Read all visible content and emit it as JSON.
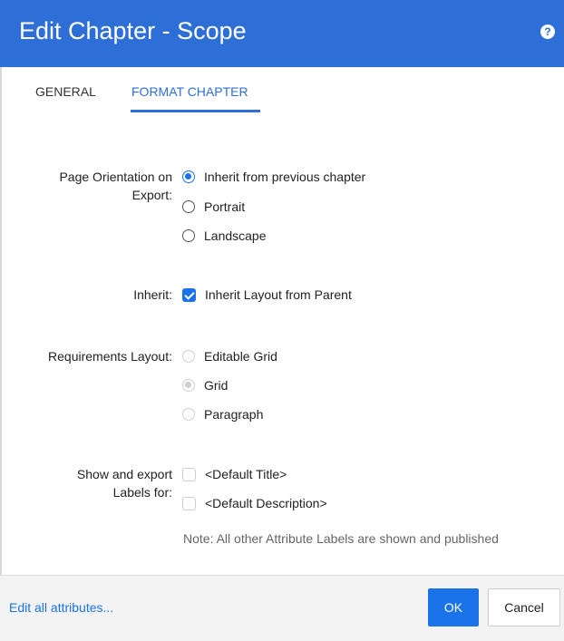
{
  "dialog": {
    "title": "Edit Chapter - Scope",
    "help_icon": "help-icon",
    "help_glyph": "?"
  },
  "tabs": [
    {
      "label": "GENERAL",
      "active": false
    },
    {
      "label": "FORMAT CHAPTER",
      "active": true
    }
  ],
  "orientation": {
    "label_line1": "Page Orientation on",
    "label_line2": "Export:",
    "options": [
      "Inherit from previous chapter",
      "Portrait",
      "Landscape"
    ],
    "selected": "Inherit from previous chapter"
  },
  "inherit": {
    "label": "Inherit:",
    "option": "Inherit Layout from Parent",
    "checked": true
  },
  "requirements_layout": {
    "label": "Requirements Layout:",
    "options": [
      "Editable Grid",
      "Grid",
      "Paragraph"
    ],
    "selected": "Grid",
    "disabled": true
  },
  "labels": {
    "label_line1": "Show and export",
    "label_line2": "Labels for:",
    "options": [
      "<Default Title>",
      "<Default Description>"
    ],
    "note": "Note: All other Attribute Labels are shown and published"
  },
  "footer": {
    "link": "Edit all attributes...",
    "ok": "OK",
    "cancel": "Cancel"
  },
  "colors": {
    "header": "#2d6fd6",
    "accent": "#1a73e8",
    "footer_bg": "#f3f3f3"
  }
}
